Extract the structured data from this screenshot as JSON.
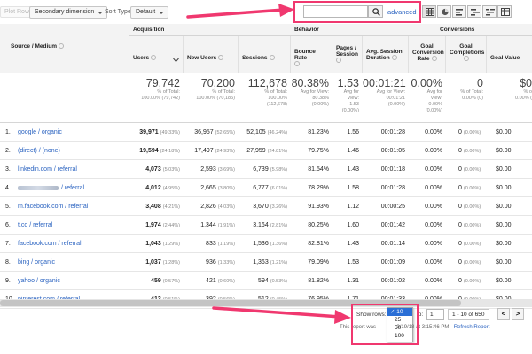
{
  "toolbar": {
    "plot_rows": "Plot Rows",
    "secondary_dimension": "Secondary dimension",
    "sort_type_label": "Sort Type:",
    "sort_type_value": "Default",
    "search_value": "",
    "advanced": "advanced"
  },
  "table": {
    "group_acquisition": "Acquisition",
    "group_behavior": "Behavior",
    "group_conversions": "Conversions",
    "col_source": "Source / Medium",
    "cols": [
      "Users",
      "New Users",
      "Sessions",
      "Bounce Rate",
      "Pages / Session",
      "Avg. Session Duration",
      "Goal Conversion Rate",
      "Goal Completions",
      "Goal Value"
    ],
    "totals": [
      {
        "big": "79,742",
        "l1": "% of Total:",
        "l2": "100.00% (79,742)"
      },
      {
        "big": "70,200",
        "l1": "% of Total:",
        "l2": "100.00% (70,185)"
      },
      {
        "big": "112,678",
        "l1": "% of Total:",
        "l2": "100.00%",
        "l3": "(112,678)"
      },
      {
        "big": "80.38%",
        "l1": "Avg for View:",
        "l2": "80.38%",
        "l3": "(0.00%)"
      },
      {
        "big": "1.53",
        "l1": "Avg for",
        "l2": "View:",
        "l3": "1.53",
        "l4": "(0.00%)"
      },
      {
        "big": "00:01:21",
        "l1": "Avg for View:",
        "l2": "00:01:21",
        "l3": "(0.00%)"
      },
      {
        "big": "0.00%",
        "l1": "Avg for",
        "l2": "View:",
        "l3": "0.00%",
        "l4": "(0.00%)"
      },
      {
        "big": "0",
        "l1": "% of Total:",
        "l2": "0.00% (0)"
      },
      {
        "big": "$0",
        "l1": "% o",
        "l2": "0.00% ("
      }
    ],
    "rows": [
      {
        "idx": "1.",
        "source": "google / organic",
        "users": "39,971",
        "users_pct": "(49.33%)",
        "new_users": "36,957",
        "new_users_pct": "(52.65%)",
        "sessions": "52,105",
        "sessions_pct": "(46.24%)",
        "bounce": "81.23%",
        "pages": "1.56",
        "duration": "00:01:28",
        "conv": "0.00%",
        "goals": "0",
        "goals_pct": "(0.00%)",
        "value": "$0.00"
      },
      {
        "idx": "2.",
        "source": "(direct) / (none)",
        "users": "19,594",
        "users_pct": "(24.18%)",
        "new_users": "17,497",
        "new_users_pct": "(24.93%)",
        "sessions": "27,959",
        "sessions_pct": "(24.81%)",
        "bounce": "79.75%",
        "pages": "1.46",
        "duration": "00:01:05",
        "conv": "0.00%",
        "goals": "0",
        "goals_pct": "(0.00%)",
        "value": "$0.00"
      },
      {
        "idx": "3.",
        "source": "linkedin.com / referral",
        "users": "4,073",
        "users_pct": "(5.03%)",
        "new_users": "2,593",
        "new_users_pct": "(3.69%)",
        "sessions": "6,739",
        "sessions_pct": "(5.98%)",
        "bounce": "81.54%",
        "pages": "1.43",
        "duration": "00:01:18",
        "conv": "0.00%",
        "goals": "0",
        "goals_pct": "(0.00%)",
        "value": "$0.00"
      },
      {
        "idx": "4.",
        "source": "/ referral",
        "blur": true,
        "users": "4,012",
        "users_pct": "(4.95%)",
        "new_users": "2,665",
        "new_users_pct": "(3.80%)",
        "sessions": "6,777",
        "sessions_pct": "(6.01%)",
        "bounce": "78.29%",
        "pages": "1.58",
        "duration": "00:01:28",
        "conv": "0.00%",
        "goals": "0",
        "goals_pct": "(0.00%)",
        "value": "$0.00"
      },
      {
        "idx": "5.",
        "source": "m.facebook.com / referral",
        "users": "3,408",
        "users_pct": "(4.21%)",
        "new_users": "2,826",
        "new_users_pct": "(4.03%)",
        "sessions": "3,670",
        "sessions_pct": "(3.26%)",
        "bounce": "91.93%",
        "pages": "1.12",
        "duration": "00:00:25",
        "conv": "0.00%",
        "goals": "0",
        "goals_pct": "(0.00%)",
        "value": "$0.00"
      },
      {
        "idx": "6.",
        "source": "t.co / referral",
        "users": "1,974",
        "users_pct": "(2.44%)",
        "new_users": "1,344",
        "new_users_pct": "(1.91%)",
        "sessions": "3,164",
        "sessions_pct": "(2.81%)",
        "bounce": "80.25%",
        "pages": "1.60",
        "duration": "00:01:42",
        "conv": "0.00%",
        "goals": "0",
        "goals_pct": "(0.00%)",
        "value": "$0.00"
      },
      {
        "idx": "7.",
        "source": "facebook.com / referral",
        "users": "1,043",
        "users_pct": "(1.29%)",
        "new_users": "833",
        "new_users_pct": "(1.19%)",
        "sessions": "1,536",
        "sessions_pct": "(1.36%)",
        "bounce": "82.81%",
        "pages": "1.43",
        "duration": "00:01:14",
        "conv": "0.00%",
        "goals": "0",
        "goals_pct": "(0.00%)",
        "value": "$0.00"
      },
      {
        "idx": "8.",
        "source": "bing / organic",
        "users": "1,037",
        "users_pct": "(1.28%)",
        "new_users": "936",
        "new_users_pct": "(1.33%)",
        "sessions": "1,363",
        "sessions_pct": "(1.21%)",
        "bounce": "79.09%",
        "pages": "1.53",
        "duration": "00:01:09",
        "conv": "0.00%",
        "goals": "0",
        "goals_pct": "(0.00%)",
        "value": "$0.00"
      },
      {
        "idx": "9.",
        "source": "yahoo / organic",
        "users": "459",
        "users_pct": "(0.57%)",
        "new_users": "421",
        "new_users_pct": "(0.60%)",
        "sessions": "594",
        "sessions_pct": "(0.53%)",
        "bounce": "81.82%",
        "pages": "1.31",
        "duration": "00:01:02",
        "conv": "0.00%",
        "goals": "0",
        "goals_pct": "(0.00%)",
        "value": "$0.00"
      },
      {
        "idx": "10.",
        "source": "pinterest.com / referral",
        "users": "413",
        "users_pct": "(0.51%)",
        "new_users": "392",
        "new_users_pct": "(0.56%)",
        "sessions": "512",
        "sessions_pct": "(0.45%)",
        "bounce": "76.95%",
        "pages": "1.71",
        "duration": "00:01:33",
        "conv": "0.00%",
        "goals": "0",
        "goals_pct": "(0.00%)",
        "value": "$0.00"
      }
    ]
  },
  "footer": {
    "show_rows": "Show rows:",
    "goto": "to:",
    "goto_value": "1",
    "page_info": "1 - 10 of 650",
    "prev": "<",
    "next": ">",
    "note_prefix": "This report was",
    "note_time": "9/19/18 at 3:15:46 PM -",
    "refresh": "Refresh Report",
    "row_options": [
      "10",
      "25",
      "50",
      "100"
    ],
    "selected_rows": "10"
  },
  "colors": {
    "annotation": "#f0386f",
    "link": "#2962c0",
    "selected": "#2b6fd6"
  }
}
